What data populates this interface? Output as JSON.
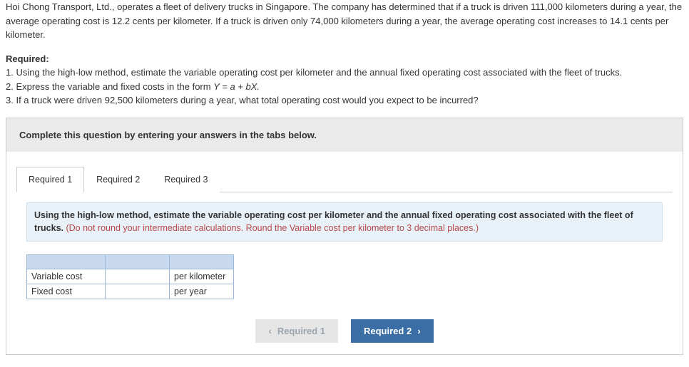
{
  "problem": {
    "para1": "Hoi Chong Transport, Ltd., operates a fleet of delivery trucks in Singapore. The company has determined that if a truck is driven 111,000 kilometers during a year, the average operating cost is 12.2 cents per kilometer. If a truck is driven only 74,000 kilometers during a year, the average operating cost increases to 14.1 cents per kilometer.",
    "required_heading": "Required:",
    "req1": "1. Using the high-low method, estimate the variable operating cost per kilometer and the annual fixed operating cost associated with the fleet of trucks.",
    "req2_prefix": "2. Express the variable and fixed costs in the form ",
    "req2_formula": "Y = a + bX.",
    "req3": "3. If a truck were driven 92,500 kilometers during a year, what total operating cost would you expect to be incurred?"
  },
  "instruction_bar": "Complete this question by entering your answers in the tabs below.",
  "tabs": {
    "t1": "Required 1",
    "t2": "Required 2",
    "t3": "Required 3"
  },
  "tab1": {
    "instr_main": "Using the high-low method, estimate the variable operating cost per kilometer and the annual fixed operating cost associated with the fleet of trucks. ",
    "instr_note": "(Do not round your intermediate calculations. Round the Variable cost per kilometer to 3 decimal places.)",
    "rows": {
      "variable": {
        "label": "Variable cost",
        "unit": "per kilometer"
      },
      "fixed": {
        "label": "Fixed cost",
        "unit": "per year"
      }
    }
  },
  "nav": {
    "prev": "Required 1",
    "next": "Required 2"
  }
}
